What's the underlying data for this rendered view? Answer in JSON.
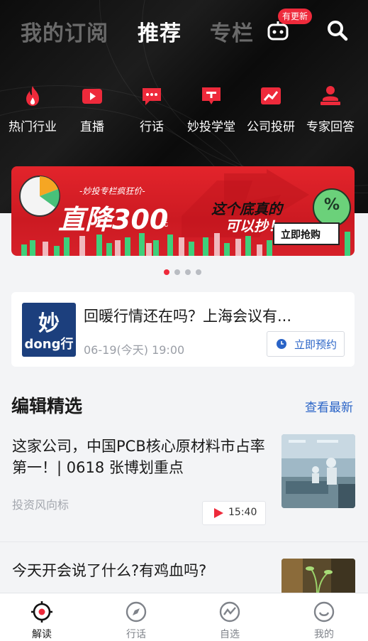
{
  "top_tabs": [
    "我的订阅",
    "推荐",
    "专栏"
  ],
  "active_tab": "推荐",
  "update_badge": "有更新",
  "categories": [
    {
      "label": "热门行业",
      "icon": "flame-icon"
    },
    {
      "label": "直播",
      "icon": "video-play-icon"
    },
    {
      "label": "行话",
      "icon": "chat-bubble-icon"
    },
    {
      "label": "妙投学堂",
      "icon": "classroom-icon"
    },
    {
      "label": "公司投研",
      "icon": "trend-chart-icon"
    },
    {
      "label": "专家回答",
      "icon": "expert-icon"
    }
  ],
  "banner": {
    "tag": "-妙投专栏疯狂价-",
    "headline": "直降300",
    "unit": "元",
    "slogan_1": "这个底真的",
    "slogan_2": "可以抄！",
    "cta": "立即抢购"
  },
  "carousel": {
    "count": 4,
    "active_index": 0
  },
  "live": {
    "logo_top": "妙",
    "logo_bottom": "dong行",
    "title": "回暖行情还在吗？上海会议有...",
    "time": "06-19(今天) 19:00",
    "button": "立即预约"
  },
  "editor_picks": {
    "title": "编辑精选",
    "more": "查看最新",
    "items": [
      {
        "title": "这家公司，中国PCB核心原材料市占率第一！| 0618 张博划重点",
        "source": "投资风向标",
        "duration": "15:40"
      },
      {
        "title": "今天开会说了什么?有鸡血吗?"
      }
    ]
  },
  "bottom_nav": [
    {
      "label": "解读",
      "icon": "target-icon",
      "active": true
    },
    {
      "label": "行话",
      "icon": "compass-icon",
      "active": false
    },
    {
      "label": "自选",
      "icon": "stock-line-icon",
      "active": false
    },
    {
      "label": "我的",
      "icon": "smile-icon",
      "active": false
    }
  ],
  "colors": {
    "accent": "#ee2a3b",
    "link": "#2a64c7",
    "dark_bg": "#111111",
    "page_bg": "#f3f4f6"
  }
}
